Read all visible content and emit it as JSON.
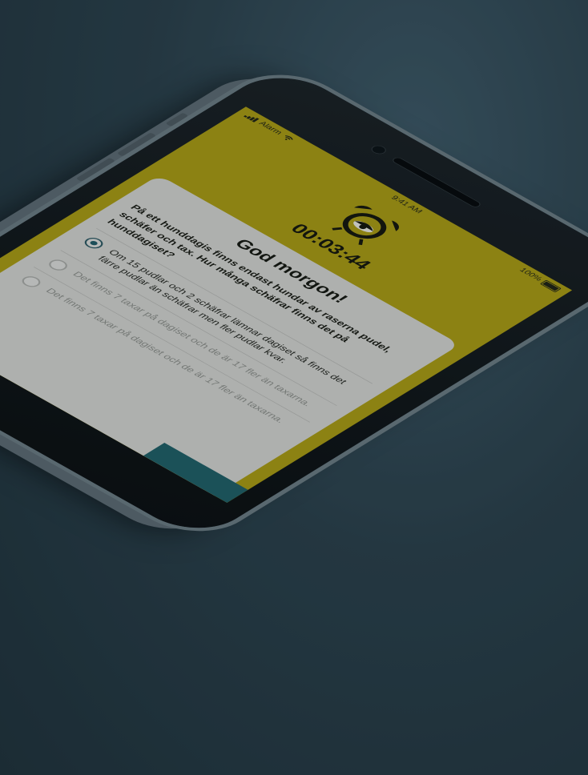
{
  "status_bar": {
    "carrier": "Alarm",
    "time": "9:41 AM",
    "battery": "100%"
  },
  "timer": "00:03:44",
  "card": {
    "title": "God morgon!",
    "question": "På ett hunddagis finns endast hundar av raserna pudel, schäfer och tax. Hur många schäfrar finns det på hunddagiset?",
    "options": [
      {
        "label": "Om 15 pudlar och 2 schäfrar lämnar dagiset så finns det färre pudlar än schäfrar men fler pudlar kvar.",
        "selected": true
      },
      {
        "label": "Det finns 7 taxar på dagiset och de är 17 fler än taxarna.",
        "selected": false
      },
      {
        "label": "Det finns 7 taxar på dagiset och de är 17 fler än taxarna.",
        "selected": false
      }
    ]
  },
  "colors": {
    "background": "#2a3f4a",
    "screen_yellow": "#a99a12",
    "card": "#d2d2cf",
    "accent_teal": "#1f5966"
  },
  "icons": {
    "clock": "alarm-clock-sleepy-icon",
    "wifi": "wifi-icon",
    "signal": "signal-icon",
    "battery": "battery-icon"
  }
}
